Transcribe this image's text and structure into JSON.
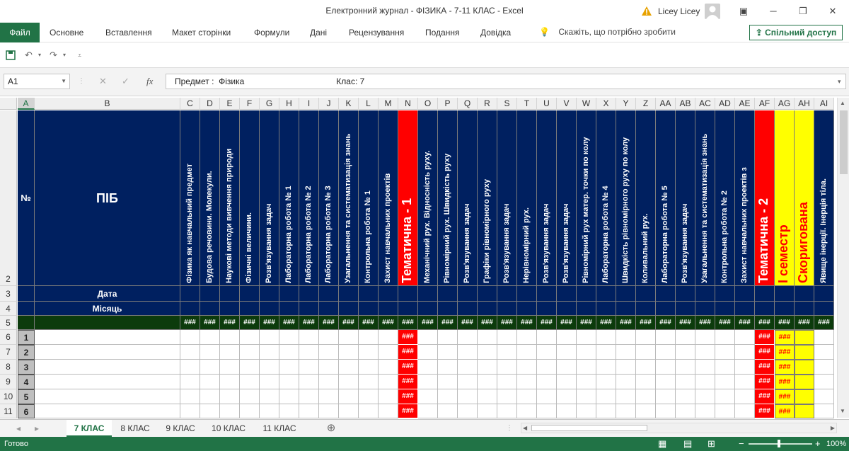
{
  "window": {
    "title": "Електронний журнал - ФІЗИКА - 7-11 КЛАС  -  Excel",
    "user": "Licey Licey",
    "colors": {
      "accent": "#217346",
      "navy": "#002060",
      "red": "#ff0000",
      "yellow": "#ffff00",
      "dark_green": "#0c3b0c"
    }
  },
  "ribbon": {
    "file": "Файл",
    "tabs": [
      "Основне",
      "Вставлення",
      "Макет сторінки",
      "Формули",
      "Дані",
      "Рецензування",
      "Подання",
      "Довідка"
    ],
    "tell_me": "Скажіть, що потрібно зробити",
    "share": "Спільний доступ"
  },
  "formula_bar": {
    "name_box": "A1",
    "content": "Предмет :  Фізика                                       Клас: 7"
  },
  "sheet": {
    "columns": [
      "A",
      "B",
      "C",
      "D",
      "E",
      "F",
      "G",
      "H",
      "I",
      "J",
      "K",
      "L",
      "M",
      "N",
      "O",
      "P",
      "Q",
      "R",
      "S",
      "T",
      "U",
      "V",
      "W",
      "X",
      "Y",
      "Z",
      "AA",
      "AB",
      "AC",
      "AD",
      "AE",
      "AF",
      "AG",
      "AH",
      "AI"
    ],
    "row_numbers": [
      "2",
      "3",
      "4",
      "5",
      "6",
      "7",
      "8",
      "9",
      "10",
      "11"
    ],
    "header_no": "№",
    "header_name": "ПІБ",
    "row_date": "Дата",
    "row_month": "Місяць",
    "vertical_headers": [
      "Фізика як навчальний предмет",
      "Будова речовини. Молекули.",
      "Наукові методи вивчення природи",
      "Фізичні величини.",
      "Розв'язування задач",
      "Лабораторна робота № 1",
      "Лабораторна робота № 2",
      "Лабораторна робота № 3",
      "Узагальнення та систематизація знань",
      "Контрольна робота № 1",
      "Захист навчальних проектів",
      "Тематична - 1",
      "Механічний рух. Відносність руху.",
      "Рівномірний рух. Швидкість руху",
      "Розв'язування задач",
      "Графіки рівномірного руху",
      "Розв'язування задач",
      "Нерівномірний рух.",
      "Розв'язування задач",
      "Розв'язування задач",
      "Рівномірний рух матер. точки по колу",
      "Лабораторна робота № 4",
      "Швидкість рівномірного руху по колу",
      "Коливальний рух.",
      "Лабораторна робота № 5",
      "Розв'язування задач",
      "Узагальнення та систематизація знань",
      "Контрольна робота № 2",
      "Захист навчальних проектів з",
      "Тематична - 2",
      "І семестр",
      "Скоригована",
      "Явище інерції. Інерція тіла."
    ],
    "hash": "###",
    "students": [
      "1",
      "2",
      "3",
      "4",
      "5",
      "6"
    ]
  },
  "sheet_tabs": [
    "7 КЛАС",
    "8 КЛАС",
    "9 КЛАС",
    "10 КЛАС",
    "11 КЛАС"
  ],
  "status": {
    "ready": "Готово",
    "zoom": "100%"
  }
}
